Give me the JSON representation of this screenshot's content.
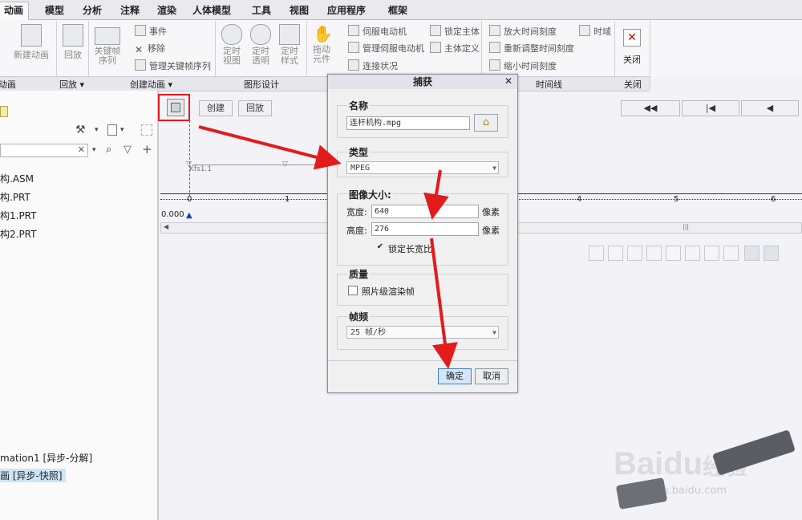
{
  "tabs": [
    "动画",
    "模型",
    "分析",
    "注释",
    "渲染",
    "人体模型",
    "工具",
    "视图",
    "应用程序",
    "框架"
  ],
  "ribbon": {
    "new_animation": "新建动画",
    "playback": "回放",
    "keyframe_seq": "关键帧序列",
    "event": "事件",
    "remove": "移除",
    "manage_keyframes": "管理关键帧序列",
    "timed_view": "定时视图",
    "timed_transparency": "定时透明",
    "timed_style": "定时样式",
    "drag_element": "拖动元件",
    "servo_motor": "伺服电动机",
    "manage_servo": "管理伺服电动机",
    "connection_status": "连接状况",
    "lock_body": "锁定主体",
    "body_definition": "主体定义",
    "zoom_in_time": "放大时间刻度",
    "readjust_time": "重新调整时间刻度",
    "zoom_out_time": "缩小时间刻度",
    "time_domain": "时域",
    "close": "关闭"
  },
  "groups": {
    "g_animation": "动画",
    "g_playback": "回放",
    "g_create": "创建动画",
    "g_graphic": "图形设计",
    "g_timeline": "时间线",
    "g_close": "关闭"
  },
  "timeline": {
    "create_btn": "创建",
    "playback_btn": "回放",
    "kfs_label": "Kfs1.1",
    "start_value": "0.000",
    "ticks": [
      "0",
      "1",
      "4",
      "5",
      "6"
    ]
  },
  "tree": {
    "items": [
      "构.ASM",
      "构.PRT",
      "构1.PRT",
      "构2.PRT"
    ],
    "animation_item": "mation1 [异步-分解]",
    "snapshot_item": "画 [异步-快照]"
  },
  "dialog": {
    "title": "捕获",
    "name_label": "名称",
    "name_value": "连杆机构.mpg",
    "type_label": "类型",
    "type_value": "MPEG",
    "size_label": "图像大小:",
    "width_label": "宽度:",
    "width_value": "640",
    "height_label": "高度:",
    "height_value": "276",
    "unit": "像素",
    "lock_ratio": "锁定长宽比",
    "quality_label": "质量",
    "photo_render": "照片级渲染帧",
    "fps_label": "帧频",
    "fps_value": "25 帧/秒",
    "ok": "确定",
    "cancel": "取消"
  },
  "watermark": {
    "brand": "Baidu",
    "brand_cn": "经验",
    "url": "jingyan.baidu.com"
  },
  "colors": {
    "annotation_red": "#e21b1b",
    "selected_blue": "#cde6f7",
    "marker_blue": "#1f3fbf"
  }
}
